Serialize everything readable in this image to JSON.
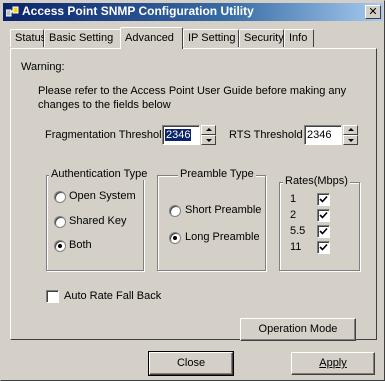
{
  "window": {
    "title": "Access Point SNMP Configuration Utility",
    "close_glyph": "✕",
    "icon": "network-app-icon"
  },
  "tabs": [
    "Status",
    "Basic Setting",
    "Advanced",
    "IP Setting",
    "Security",
    "Info"
  ],
  "active_tab": "Advanced",
  "warning": {
    "label": "Warning:",
    "line1": "Please refer to the Access Point User Guide before making any",
    "line2": "changes to the fields below"
  },
  "fragmentation": {
    "label": "Fragmentation Threshold",
    "value": "2346"
  },
  "rts": {
    "label": "RTS Threshold",
    "value": "2346"
  },
  "authentication": {
    "title": "Authentication Type",
    "options": [
      "Open System",
      "Shared Key",
      "Both"
    ],
    "selected": "Both"
  },
  "preamble": {
    "title": "Preamble Type",
    "options": [
      "Short Preamble",
      "Long Preamble"
    ],
    "selected": "Long Preamble"
  },
  "rates": {
    "title": "Rates(Mbps)",
    "items": [
      {
        "label": "1",
        "checked": true
      },
      {
        "label": "2",
        "checked": true
      },
      {
        "label": "5.5",
        "checked": true
      },
      {
        "label": "11",
        "checked": true
      }
    ]
  },
  "auto_rate": {
    "label": "Auto Rate Fall Back",
    "checked": false
  },
  "buttons": {
    "operation_mode": "Operation Mode",
    "close": "Close",
    "apply": "Apply"
  }
}
